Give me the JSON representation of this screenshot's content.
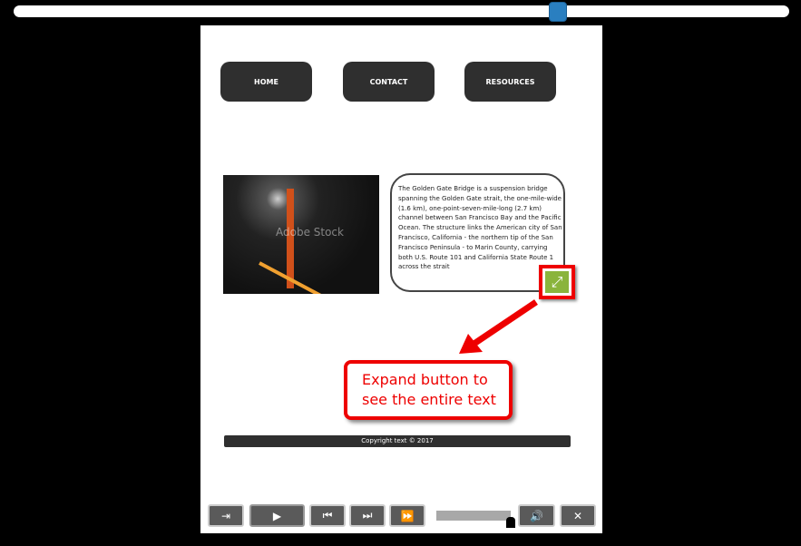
{
  "scrubber": {
    "position": 0.7,
    "color": "#2a7fc0"
  },
  "nav": [
    {
      "label": "HOME"
    },
    {
      "label": "CONTACT"
    },
    {
      "label": "RESOURCES"
    }
  ],
  "image": {
    "watermark": "Adobe Stock"
  },
  "textbox": {
    "text": "The Golden Gate Bridge is a suspension bridge spanning the Golden Gate strait, the one-mile-wide (1.6 km), one-point-seven-mile-long (2.7 km) channel between San Francisco Bay and the Pacific Ocean. The structure links the American city of San Francisco, California - the northern tip of the San Francisco Peninsula - to Marin County, carrying both U.S. Route 101 and California State Route 1 across the strait"
  },
  "expand_button": {
    "icon": "expand-icon",
    "color": "#8ab43c"
  },
  "callout": {
    "text": "Expand button to see the entire text",
    "color": "#e00000"
  },
  "footer": {
    "text": "Copyright text © 2017"
  },
  "player": {
    "exit": "⇥",
    "play": "▶",
    "prev": "⏮",
    "next": "⏭",
    "forward": "⏩",
    "volume": "🔊",
    "close": "✕",
    "progress": 1.0
  }
}
